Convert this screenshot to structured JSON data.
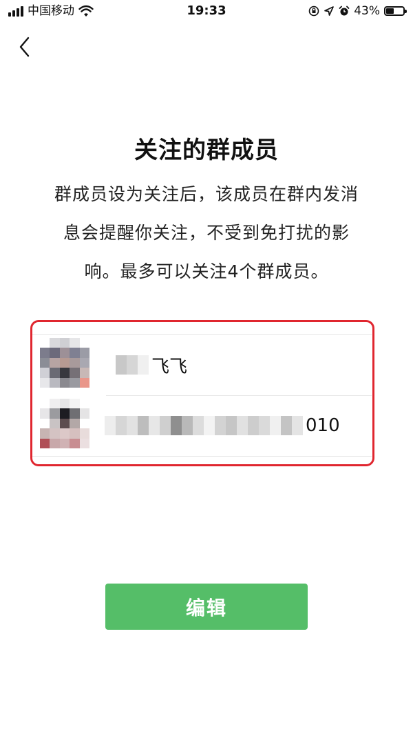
{
  "status_bar": {
    "carrier": "中国移动",
    "time": "19:33",
    "battery_percent": "43%",
    "battery_level": 0.43,
    "icons": [
      "signal-icon",
      "wifi-icon",
      "orientation-lock-icon",
      "location-icon",
      "alarm-icon",
      "battery-icon"
    ]
  },
  "nav": {
    "back_icon": "chevron-left-icon"
  },
  "page": {
    "title": "关注的群成员",
    "description": "群成员设为关注后，该成员在群内发消息会提醒你关注，不受到免打扰的影响。最多可以关注4个群成员。"
  },
  "members": [
    {
      "name_visible": "飞飞",
      "avatar_colors": [
        "#ffffff",
        "#d9d9dc",
        "#cfcfd3",
        "#e6e6e8",
        "#ffffff",
        "#7c7c8c",
        "#6c6a7b",
        "#9d9097",
        "#7f8092",
        "#9b9ca6",
        "#8b8d96",
        "#b7a4a3",
        "#b79a92",
        "#a89a9b",
        "#a9a8b1",
        "#d0d0d6",
        "#6a6a74",
        "#38383e",
        "#767076",
        "#c8b8b6",
        "#e7e7ea",
        "#b9b9c0",
        "#8a898f",
        "#9a9aa0",
        "#e9968a"
      ],
      "blur_colors": [
        "#ffffff",
        "#c8c8c8",
        "#d6d6d6",
        "#f0f0f0"
      ]
    },
    {
      "name_visible": "010",
      "avatar_colors": [
        "#ffffff",
        "#f0eff0",
        "#e6e6e7",
        "#f4f4f4",
        "#ffffff",
        "#e7e6e8",
        "#9b9b9f",
        "#1d1d22",
        "#6f6f73",
        "#e5e4e5",
        "#ffffff",
        "#c9c3c4",
        "#5d4d4f",
        "#b3a8a7",
        "#ffffff",
        "#c7b4b3",
        "#d4c3c3",
        "#dcc8c8",
        "#d6c0bf",
        "#e8dcdb",
        "#b04f57",
        "#c8a8aa",
        "#d0b2b4",
        "#c88d91",
        "#ebdfe0"
      ],
      "blur_colors": [
        "#ededed",
        "#d6d6d6",
        "#e2e2e2",
        "#bdbdbd",
        "#e7e7e7",
        "#cfcfcf",
        "#8f8f8f",
        "#b9b9b9",
        "#dcdcdc",
        "#f3f3f3",
        "#d3d3d3",
        "#c6c6c6",
        "#e1e1e1",
        "#cdcdcd",
        "#dadada",
        "#f0f0f0",
        "#c4c4c4",
        "#e4e4e4"
      ]
    }
  ],
  "actions": {
    "edit_label": "编辑"
  },
  "colors": {
    "accent": "#55be68",
    "annotation": "#e0262f"
  }
}
